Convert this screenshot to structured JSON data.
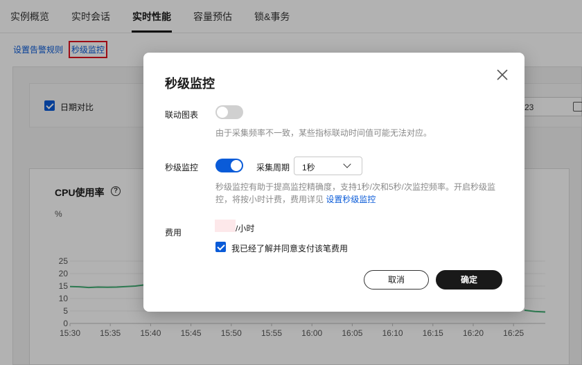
{
  "nav": {
    "tabs": [
      {
        "label": "实例概览"
      },
      {
        "label": "实时会话"
      },
      {
        "label": "实时性能"
      },
      {
        "label": "容量预估"
      },
      {
        "label": "锁&事务"
      }
    ],
    "active_tab": "实时性能"
  },
  "subbar": {
    "alert_rules_link": "设置告警规则",
    "second_monitor_link": "秒级监控"
  },
  "filter": {
    "date_compare_label": "日期对比",
    "date_compare_checked": true,
    "date_value_partial": "23"
  },
  "chart": {
    "title": "CPU使用率",
    "help_icon": "question-circle-icon",
    "unit": "%"
  },
  "chart_data": {
    "type": "line",
    "title": "CPU使用率",
    "ylabel": "%",
    "xlabel": "",
    "ylim": [
      0,
      25
    ],
    "yticks": [
      "0",
      "5",
      "10",
      "15",
      "20",
      "25"
    ],
    "x": [
      "15:30",
      "15:35",
      "15:40",
      "15:45",
      "15:50",
      "15:55",
      "16:00",
      "16:05",
      "16:10",
      "16:15",
      "16:20",
      "16:25"
    ],
    "series": [
      {
        "color": "#3fae73",
        "left_segment": [
          [
            0,
            14.8
          ],
          [
            1,
            14.7
          ],
          [
            2,
            14.4
          ],
          [
            3,
            14.6
          ],
          [
            4,
            14.5
          ],
          [
            5,
            14.6
          ],
          [
            6,
            14.8
          ],
          [
            7,
            15.0
          ],
          [
            8,
            15.5
          ]
        ],
        "right_segment": [
          [
            0,
            5.3
          ],
          [
            1,
            4.8
          ],
          [
            2,
            4.6
          ]
        ]
      }
    ],
    "grid": true
  },
  "modal": {
    "title": "秒级监控",
    "close_icon": "close-icon",
    "linked_chart_label": "联动图表",
    "linked_chart_on": false,
    "linked_chart_hint": "由于采集频率不一致，某些指标联动时间值可能无法对应。",
    "second_monitor_label": "秒级监控",
    "second_monitor_on": true,
    "period_label": "采集周期",
    "period_value": "1秒",
    "second_monitor_hint": "秒级监控有助于提高监控精确度，支持1秒/次和5秒/次监控频率。开启秒级监控，将按小时计费，费用详见",
    "second_monitor_hint_link": "设置秒级监控",
    "fee_label": "费用",
    "fee_unit": "/小时",
    "agree_label": "我已经了解并同意支付该笔费用",
    "agree_checked": true,
    "cancel_label": "取消",
    "ok_label": "确定"
  },
  "colors": {
    "accent": "#0a5bd8",
    "highlight_box": "#e0121f",
    "line": "#3fae73",
    "primary_button": "#191919"
  }
}
